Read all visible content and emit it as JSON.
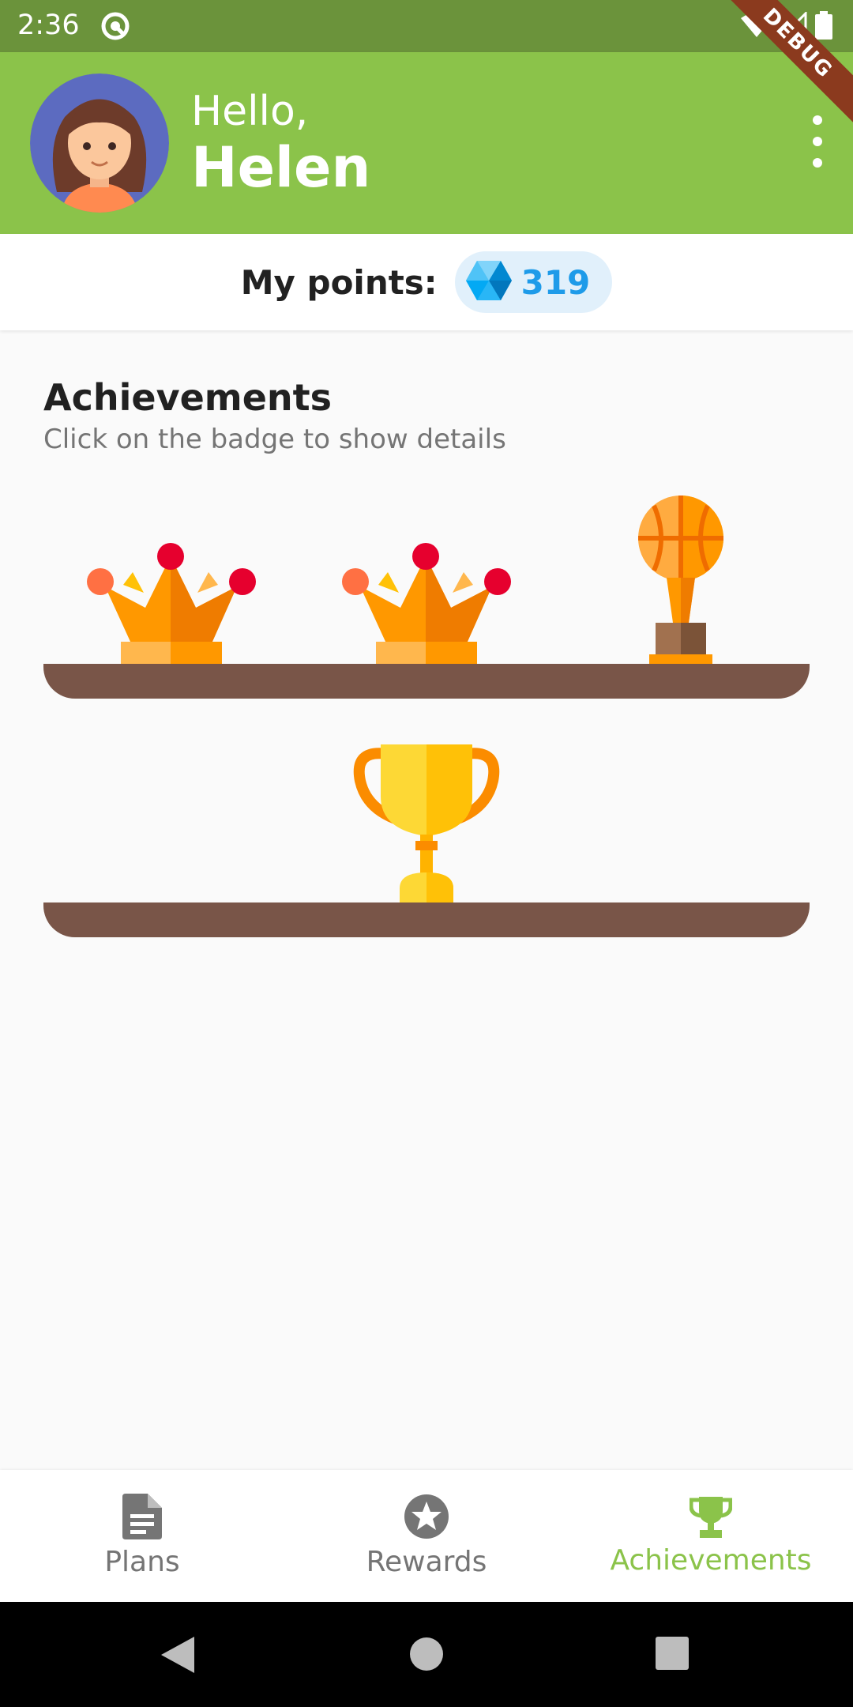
{
  "status_bar": {
    "time": "2:36",
    "debug_label": "DEBUG"
  },
  "header": {
    "greeting": "Hello,",
    "name": "Helen"
  },
  "points": {
    "label": "My points:",
    "value": "319"
  },
  "achievements": {
    "title": "Achievements",
    "subtitle": "Click on the badge to show details",
    "badges": [
      {
        "icon": "crown-icon"
      },
      {
        "icon": "crown-icon"
      },
      {
        "icon": "basketball-trophy-icon"
      },
      {
        "icon": "gold-cup-icon"
      }
    ]
  },
  "bottom_nav": {
    "items": [
      {
        "label": "Plans",
        "icon": "document-icon"
      },
      {
        "label": "Rewards",
        "icon": "star-icon"
      },
      {
        "label": "Achievements",
        "icon": "trophy-icon"
      }
    ],
    "active_index": 2
  },
  "colors": {
    "primary": "#8bc34a",
    "status_bar": "#6b933b",
    "points_accent": "#1e9be9",
    "shelf": "#795548"
  }
}
